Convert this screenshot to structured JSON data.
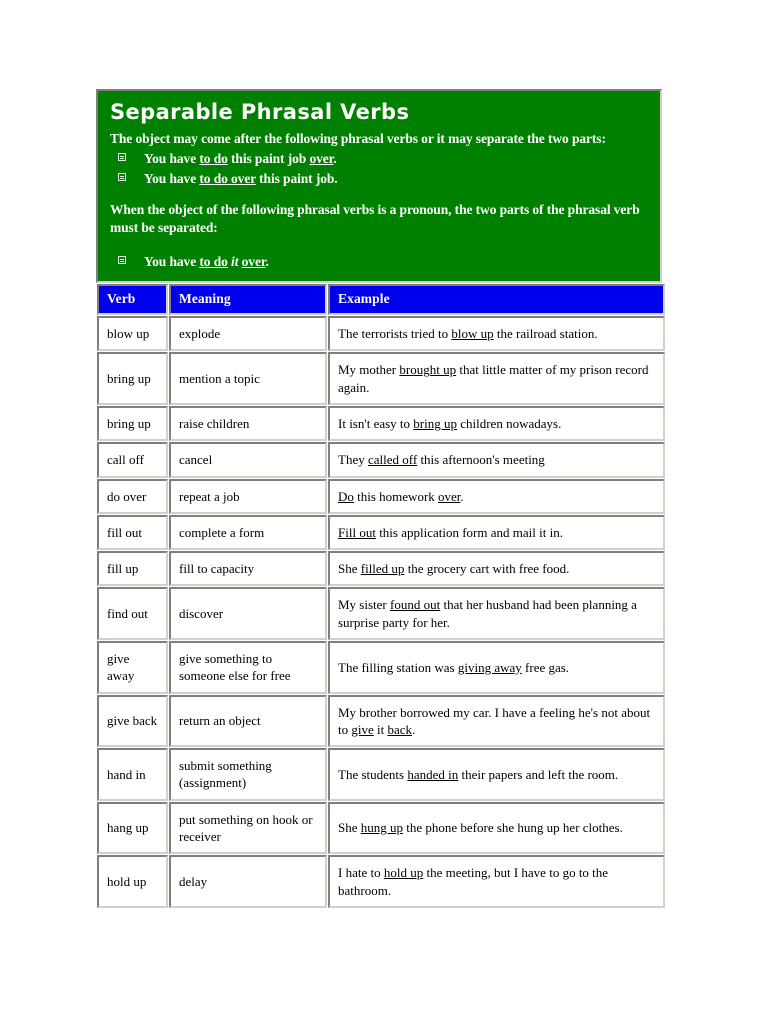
{
  "colors": {
    "panel_bg": "#008000",
    "panel_text": "#ffffff",
    "header_bg": "#0000ee",
    "header_text": "#ffffff",
    "page_bg": "#ffffff",
    "cell_text": "#000000"
  },
  "intro": {
    "title": "Separable Phrasal Verbs",
    "paragraph1": "The object may come after the following phrasal verbs or it may separate the two parts:",
    "bullets1": [
      {
        "pre": "You have ",
        "u1": "to do",
        "mid": " this paint job ",
        "u2": "over",
        "post": "."
      },
      {
        "pre": "You have ",
        "u1": "to do over",
        "mid": " this paint job.",
        "u2": "",
        "post": ""
      }
    ],
    "paragraph2": "When the object of the following phrasal verbs is a pronoun, the two parts of the phrasal verb must be separated:",
    "bullets2": [
      {
        "pre": "You have ",
        "u1": "to do",
        "mid": " ",
        "em": "it",
        "mid2": " ",
        "u2": "over",
        "post": "."
      }
    ]
  },
  "table": {
    "columns": [
      "Verb",
      "Meaning",
      "Example"
    ],
    "rows": [
      {
        "verb": "blow up",
        "meaning": "explode",
        "example_pre": "The terrorists tried to ",
        "example_u": "blow up",
        "example_post": " the railroad station."
      },
      {
        "verb": "bring up",
        "meaning": "mention a topic",
        "example_pre": "My mother ",
        "example_u": "brought up",
        "example_post": " that little matter of my prison record again."
      },
      {
        "verb": "bring up",
        "meaning": "raise children",
        "example_pre": "It isn't easy to ",
        "example_u": "bring up",
        "example_post": " children nowadays."
      },
      {
        "verb": "call off",
        "meaning": "cancel",
        "example_pre": "They ",
        "example_u": "called off",
        "example_post": " this afternoon's meeting"
      },
      {
        "verb": "do over",
        "meaning": "repeat a job",
        "example_pre": "",
        "example_u": "Do",
        "example_post": " this homework ",
        "example_u2": "over",
        "example_post2": "."
      },
      {
        "verb": "fill out",
        "meaning": "complete a form",
        "example_pre": "",
        "example_u": "Fill out",
        "example_post": " this application form and mail it in."
      },
      {
        "verb": "fill up",
        "meaning": "fill to capacity",
        "example_pre": "She ",
        "example_u": "filled up",
        "example_post": " the grocery cart with free food."
      },
      {
        "verb": "find out",
        "meaning": "discover",
        "example_pre": "My sister ",
        "example_u": "found out",
        "example_post": " that her husband had been planning a surprise party for her."
      },
      {
        "verb": "give away",
        "meaning": "give something to someone else for free",
        "example_pre": "The filling station was ",
        "example_u": "giving away",
        "example_post": " free gas."
      },
      {
        "verb": "give back",
        "meaning": "return an object",
        "example_pre": "My brother borrowed my car. I have a feeling he's not about to ",
        "example_u": "give",
        "example_post": " it ",
        "example_u2": "back",
        "example_post2": "."
      },
      {
        "verb": "hand in",
        "meaning": "submit something (assignment)",
        "example_pre": "The students ",
        "example_u": "handed in",
        "example_post": " their papers and left the room."
      },
      {
        "verb": "hang up",
        "meaning": "put something on hook or receiver",
        "example_pre": "She ",
        "example_u": "hung up",
        "example_post": " the phone before she hung up her clothes."
      },
      {
        "verb": "hold up",
        "meaning": "delay",
        "example_pre": "I hate to ",
        "example_u": "hold up",
        "example_post": " the meeting, but I have to go to the bathroom."
      }
    ]
  }
}
